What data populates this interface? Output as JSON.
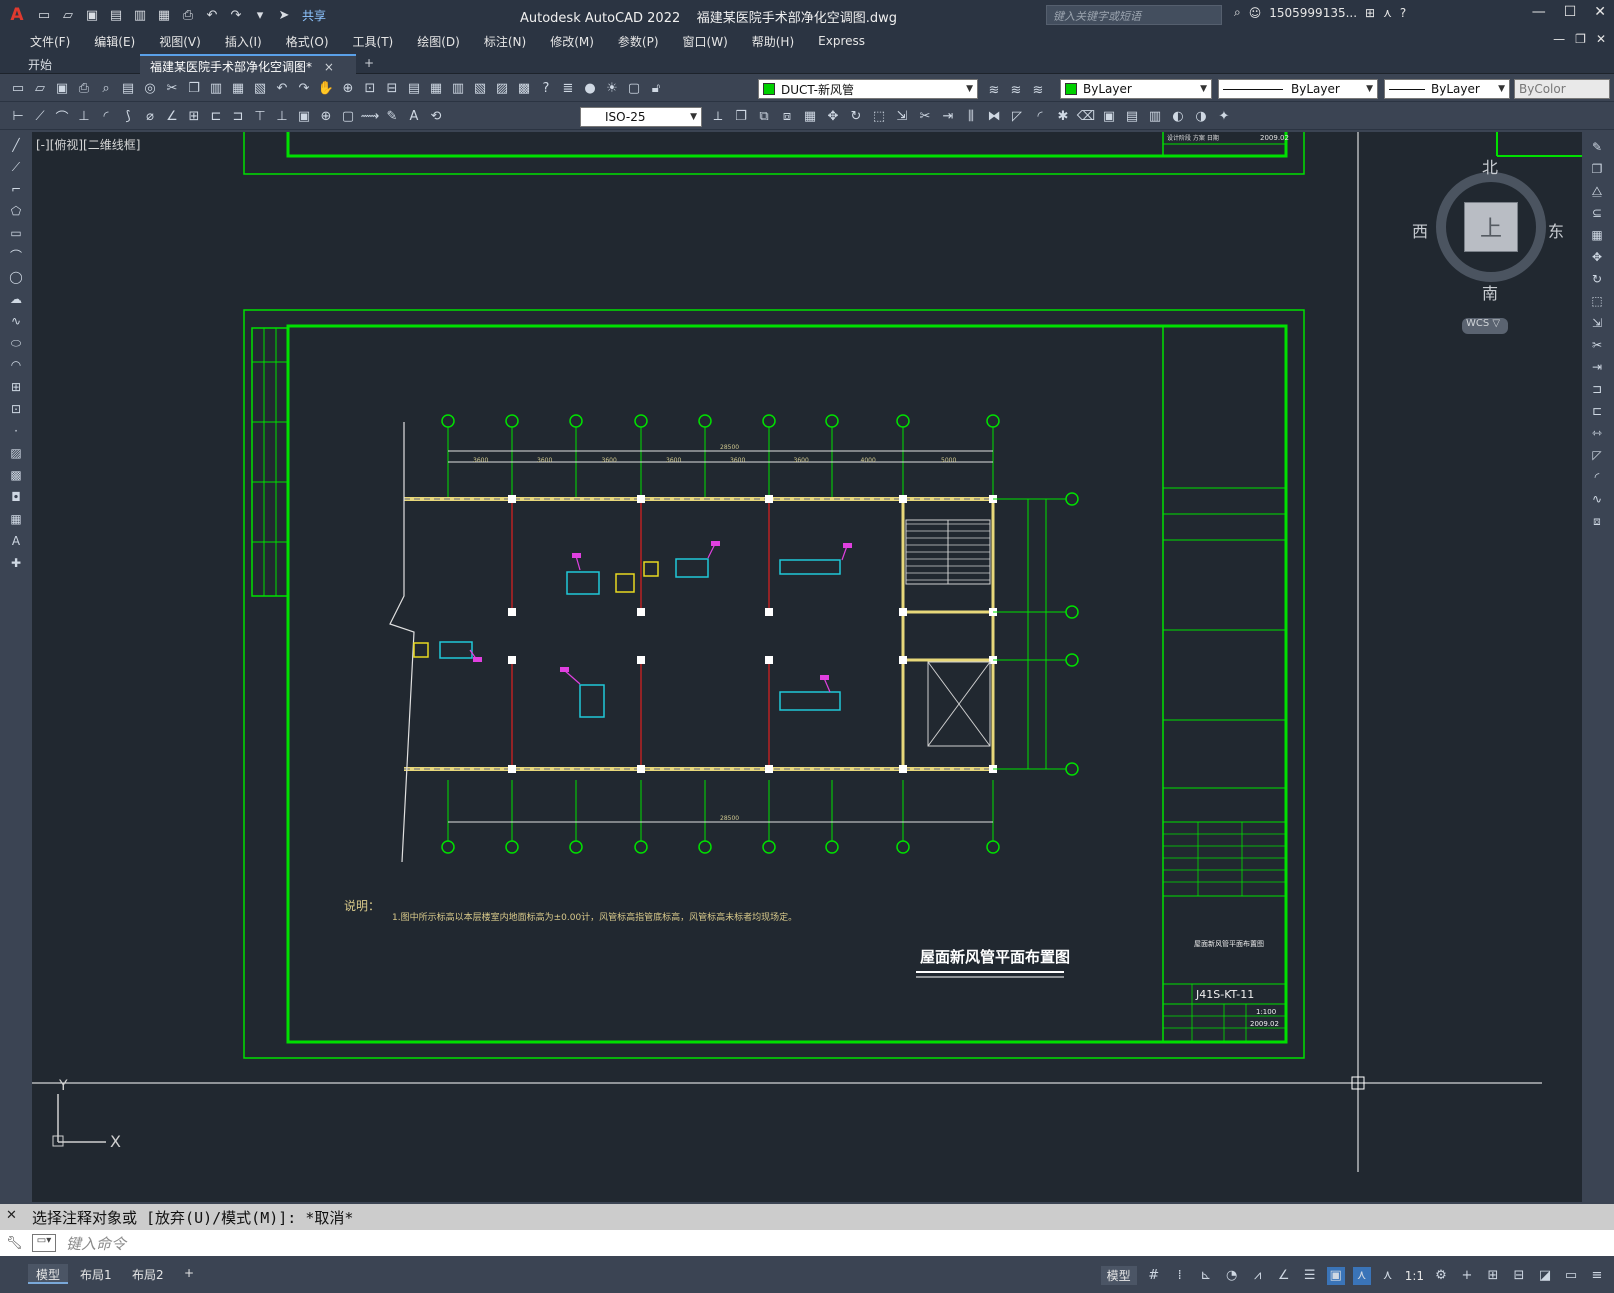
{
  "app": {
    "title": "Autodesk AutoCAD 2022",
    "document": "福建某医院手术部净化空调图.dwg",
    "share_label": "共享",
    "search_placeholder": "键入关键字或短语",
    "user": "1505999135...",
    "help": "?"
  },
  "menus": [
    "文件(F)",
    "编辑(E)",
    "视图(V)",
    "插入(I)",
    "格式(O)",
    "工具(T)",
    "绘图(D)",
    "标注(N)",
    "修改(M)",
    "参数(P)",
    "窗口(W)",
    "帮助(H)",
    "Express"
  ],
  "tabs": {
    "start": "开始",
    "active": "福建某医院手术部净化空调图*",
    "close": "×",
    "add": "+"
  },
  "toolbar": {
    "layer": "DUCT-新风管",
    "color": "ByLayer",
    "linetype": "ByLayer",
    "lineweight": "ByLayer",
    "plotstyle": "ByColor",
    "dimstyle": "ISO-25",
    "layer_color": "#00d000"
  },
  "canvas": {
    "view_label": "[-][俯视][二维线框]",
    "viewcube": {
      "north": "北",
      "south": "南",
      "east": "东",
      "west": "西",
      "top": "上",
      "wcs": "WCS ▽"
    },
    "ucs_x": "X",
    "ucs_y": "Y"
  },
  "drawing": {
    "notes_title": "说明：",
    "notes_text": "1.图中所示标高以本层楼室内地面标高为±0.00计，风管标高指管底标高，风管标高未标者均现场定。",
    "plan_title": "屋面新风管平面布置图",
    "drawing_number": "J41S-KT-11",
    "scale": "1:100",
    "date": "2009.02",
    "titleblock_name": "屋面新风管平面布置图",
    "dim_total": "28500",
    "dims": [
      "3600",
      "3600",
      "3600",
      "3600",
      "3600",
      "3600",
      "4000",
      "5000"
    ]
  },
  "command": {
    "history": "选择注释对象或 [放弃(U)/模式(M)]: *取消*",
    "input_placeholder": "键入命令"
  },
  "status": {
    "tabs": [
      "模型",
      "布局1",
      "布局2",
      "+"
    ],
    "model_label": "模型",
    "scale": "1:1"
  }
}
